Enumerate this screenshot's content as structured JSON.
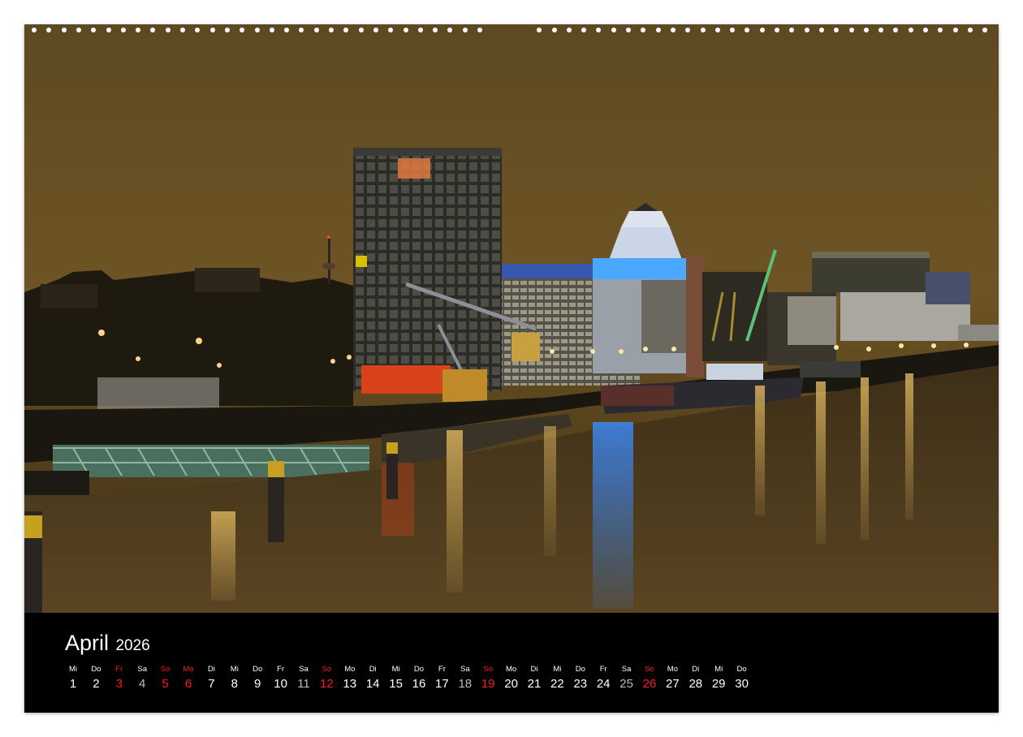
{
  "photo": {
    "description_icon": "cologne-rheinauhafen-night-photo",
    "colors": {
      "sky": "#6e5420",
      "water": "#5a4320",
      "accent_blue": "#3b8cff"
    }
  },
  "calendar": {
    "month": "April",
    "year": "2026",
    "days": [
      {
        "wd": "Mi",
        "n": "1",
        "kind": "weekday"
      },
      {
        "wd": "Do",
        "n": "2",
        "kind": "weekday"
      },
      {
        "wd": "Fr",
        "n": "3",
        "kind": "holiday"
      },
      {
        "wd": "Sa",
        "n": "4",
        "kind": "saturday"
      },
      {
        "wd": "So",
        "n": "5",
        "kind": "sunday"
      },
      {
        "wd": "Mo",
        "n": "6",
        "kind": "holiday"
      },
      {
        "wd": "Di",
        "n": "7",
        "kind": "weekday"
      },
      {
        "wd": "Mi",
        "n": "8",
        "kind": "weekday"
      },
      {
        "wd": "Do",
        "n": "9",
        "kind": "weekday"
      },
      {
        "wd": "Fr",
        "n": "10",
        "kind": "weekday"
      },
      {
        "wd": "Sa",
        "n": "11",
        "kind": "saturday"
      },
      {
        "wd": "So",
        "n": "12",
        "kind": "sunday"
      },
      {
        "wd": "Mo",
        "n": "13",
        "kind": "weekday"
      },
      {
        "wd": "Di",
        "n": "14",
        "kind": "weekday"
      },
      {
        "wd": "Mi",
        "n": "15",
        "kind": "weekday"
      },
      {
        "wd": "Do",
        "n": "16",
        "kind": "weekday"
      },
      {
        "wd": "Fr",
        "n": "17",
        "kind": "weekday"
      },
      {
        "wd": "Sa",
        "n": "18",
        "kind": "saturday"
      },
      {
        "wd": "So",
        "n": "19",
        "kind": "sunday"
      },
      {
        "wd": "Mo",
        "n": "20",
        "kind": "weekday"
      },
      {
        "wd": "Di",
        "n": "21",
        "kind": "weekday"
      },
      {
        "wd": "Mi",
        "n": "22",
        "kind": "weekday"
      },
      {
        "wd": "Do",
        "n": "23",
        "kind": "weekday"
      },
      {
        "wd": "Fr",
        "n": "24",
        "kind": "weekday"
      },
      {
        "wd": "Sa",
        "n": "25",
        "kind": "saturday"
      },
      {
        "wd": "So",
        "n": "26",
        "kind": "sunday"
      },
      {
        "wd": "Mo",
        "n": "27",
        "kind": "weekday"
      },
      {
        "wd": "Di",
        "n": "28",
        "kind": "weekday"
      },
      {
        "wd": "Mi",
        "n": "29",
        "kind": "weekday"
      },
      {
        "wd": "Do",
        "n": "30",
        "kind": "weekday"
      }
    ]
  }
}
